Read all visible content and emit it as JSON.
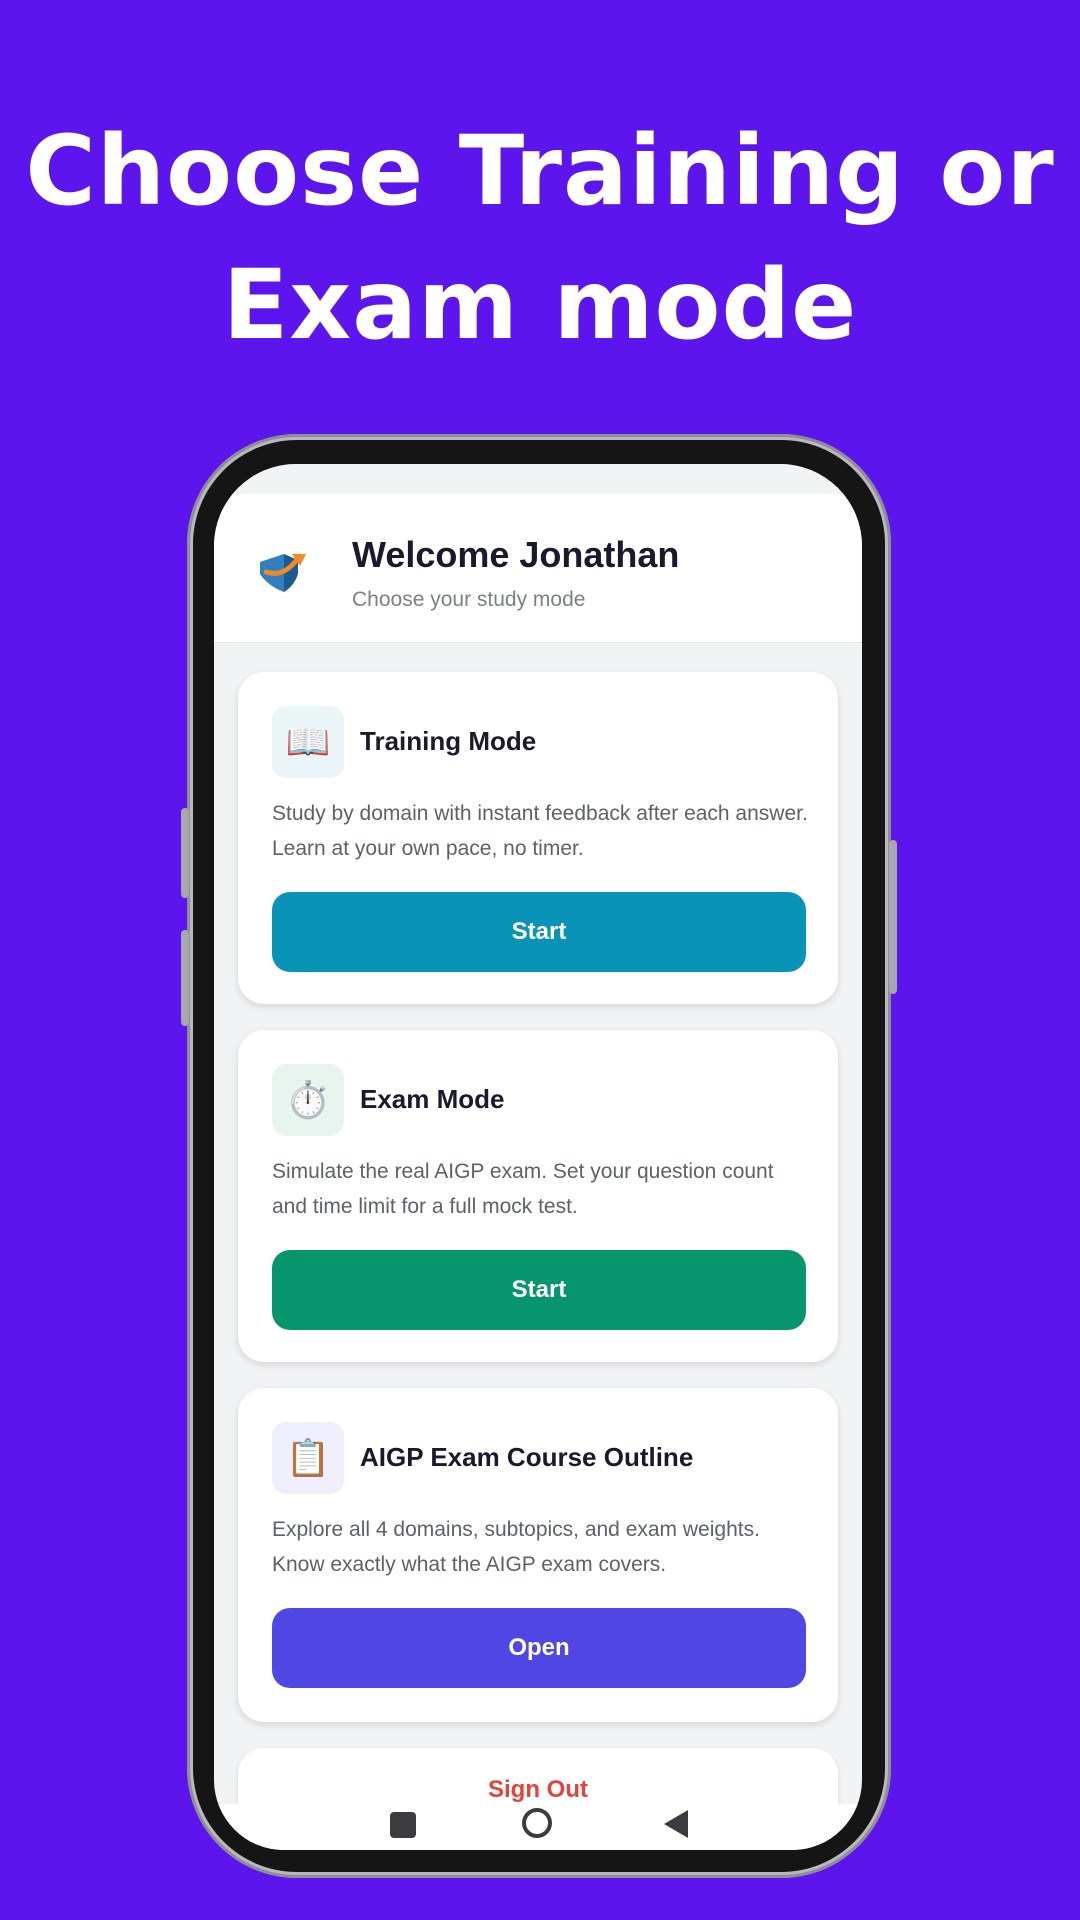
{
  "promo": {
    "headline_line1": "Choose Training or",
    "headline_line2": "Exam mode"
  },
  "header": {
    "welcome": "Welcome Jonathan",
    "subtitle": "Choose your study mode"
  },
  "cards": [
    {
      "icon": "open-book-icon",
      "title": "Training Mode",
      "description": "Study by domain with instant feedback after each answer. Learn at your own pace, no timer.",
      "button": "Start",
      "color": "#0893b7"
    },
    {
      "icon": "stopwatch-icon",
      "title": "Exam Mode",
      "description": "Simulate the real AIGP exam. Set your question count and time limit for a full mock test.",
      "button": "Start",
      "color": "#07966b"
    },
    {
      "icon": "clipboard-icon",
      "title": "AIGP Exam Course Outline",
      "description": "Explore all 4 domains, subtopics, and exam weights. Know exactly what the AIGP exam covers.",
      "button": "Open",
      "color": "#5046e4"
    }
  ],
  "signout": {
    "label": "Sign Out",
    "color": "#e0443b"
  },
  "colors": {
    "background": "#5c15ec",
    "title_text": "#1a1a2e"
  }
}
